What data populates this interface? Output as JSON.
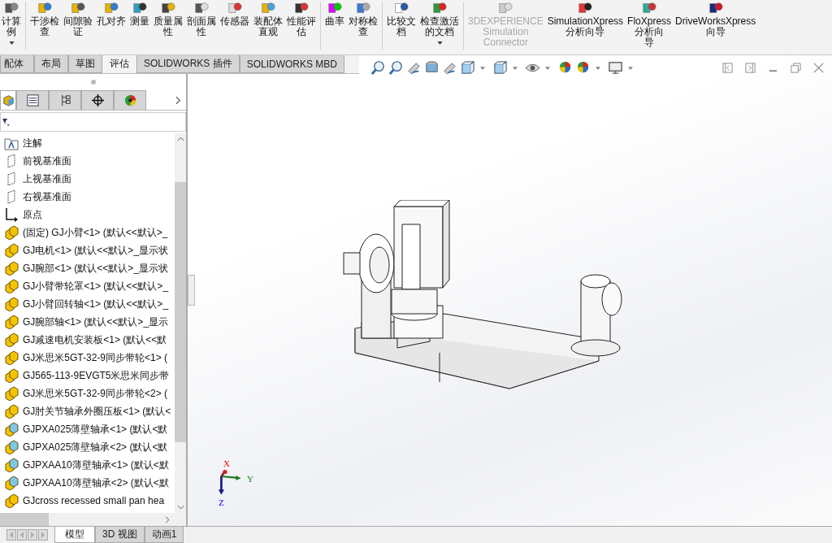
{
  "ribbon": {
    "groups": [
      {
        "buttons": [
          {
            "lines": [
              "计算",
              "例"
            ],
            "disabled": false,
            "menu": true
          }
        ]
      },
      {
        "buttons": [
          {
            "lines": [
              "干涉检",
              "查"
            ],
            "disabled": false,
            "menu": false
          },
          {
            "lines": [
              "间隙验",
              "证"
            ],
            "disabled": false,
            "menu": false
          },
          {
            "lines": [
              "孔对齐"
            ],
            "disabled": false,
            "menu": false
          },
          {
            "lines": [
              "测量"
            ],
            "disabled": false,
            "menu": false
          },
          {
            "lines": [
              "质量属",
              "性"
            ],
            "disabled": false,
            "menu": false
          },
          {
            "lines": [
              "剖面属",
              "性"
            ],
            "disabled": false,
            "menu": false
          },
          {
            "lines": [
              "传感器"
            ],
            "disabled": false,
            "menu": false
          },
          {
            "lines": [
              "装配体",
              "直观"
            ],
            "disabled": false,
            "menu": false
          },
          {
            "lines": [
              "性能评",
              "估"
            ],
            "disabled": false,
            "menu": false
          }
        ]
      },
      {
        "buttons": [
          {
            "lines": [
              "曲率"
            ],
            "disabled": false,
            "menu": false
          },
          {
            "lines": [
              "对称检",
              "查"
            ],
            "disabled": false,
            "menu": false
          }
        ]
      },
      {
        "buttons": [
          {
            "lines": [
              "比较文",
              "档"
            ],
            "disabled": false,
            "menu": false
          },
          {
            "lines": [
              "检查激活",
              "的文档"
            ],
            "disabled": false,
            "menu": true
          }
        ]
      },
      {
        "buttons": [
          {
            "lines": [
              "3DEXPERIENCE",
              "Simulation",
              "Connector"
            ],
            "disabled": true,
            "menu": false
          },
          {
            "lines": [
              "SimulationXpress",
              "分析向导"
            ],
            "disabled": false,
            "menu": false
          },
          {
            "lines": [
              "FloXpress",
              "分析向",
              "导"
            ],
            "disabled": false,
            "menu": false
          },
          {
            "lines": [
              "DriveWorksXpress",
              "向导"
            ],
            "disabled": false,
            "menu": false
          }
        ]
      }
    ]
  },
  "command_tabs": [
    {
      "label": "配体",
      "selected": false
    },
    {
      "label": "布局",
      "selected": false
    },
    {
      "label": "草图",
      "selected": false
    },
    {
      "label": "评估",
      "selected": true
    },
    {
      "label": "SOLIDWORKS 插件",
      "selected": false
    },
    {
      "label": "SOLIDWORKS MBD",
      "selected": false
    }
  ],
  "panel_tabs": [
    {
      "selected": true
    },
    {
      "selected": false
    },
    {
      "selected": false
    },
    {
      "selected": false
    },
    {
      "selected": false
    }
  ],
  "tree": [
    {
      "kind": "annotation",
      "label": "注解"
    },
    {
      "kind": "plane",
      "label": "前视基准面"
    },
    {
      "kind": "plane",
      "label": "上视基准面"
    },
    {
      "kind": "plane",
      "label": "右视基准面"
    },
    {
      "kind": "origin",
      "label": "原点"
    },
    {
      "kind": "part",
      "label": "(固定) GJ小臂<1> (默认<<默认>_"
    },
    {
      "kind": "part",
      "label": "GJ电机<1> (默认<<默认>_显示状"
    },
    {
      "kind": "part",
      "label": "GJ腕部<1> (默认<<默认>_显示状"
    },
    {
      "kind": "part",
      "label": "GJ小臂带轮罩<1> (默认<<默认>_"
    },
    {
      "kind": "part",
      "label": "GJ小臂回转轴<1> (默认<<默认>_"
    },
    {
      "kind": "part",
      "label": "GJ腕部轴<1> (默认<<默认>_显示"
    },
    {
      "kind": "part",
      "label": "GJ减速电机安装板<1> (默认<<默"
    },
    {
      "kind": "part",
      "label": "GJ米思米5GT-32-9同步带轮<1> ("
    },
    {
      "kind": "part",
      "label": "GJ565-113-9EVGT5米思米同步带"
    },
    {
      "kind": "part",
      "label": "GJ米思米5GT-32-9同步带轮<2> ("
    },
    {
      "kind": "part",
      "label": "GJ肘关节轴承外圈压板<1> (默认<"
    },
    {
      "kind": "toolbox-part",
      "label": "GJPXA025薄壁轴承<1> (默认<默"
    },
    {
      "kind": "toolbox-part",
      "label": "GJPXA025薄壁轴承<2> (默认<默"
    },
    {
      "kind": "toolbox-part",
      "label": "GJPXAA10薄壁轴承<1> (默认<默"
    },
    {
      "kind": "toolbox-part",
      "label": "GJPXAA10薄壁轴承<2> (默认<默"
    },
    {
      "kind": "part",
      "label": "GJcross recessed small pan hea"
    }
  ],
  "triad": {
    "x": "X",
    "y": "Y",
    "z": "Z"
  },
  "bottom_tabs": [
    {
      "label": "模型",
      "selected": true
    },
    {
      "label": "3D 视图",
      "selected": false
    },
    {
      "label": "动画1",
      "selected": false
    }
  ]
}
